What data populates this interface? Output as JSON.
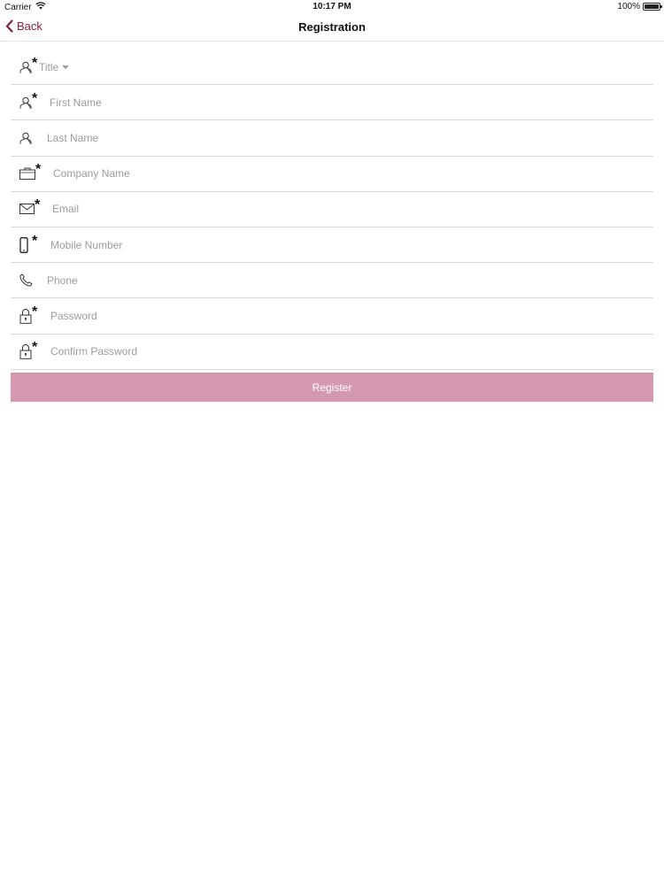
{
  "status_bar": {
    "carrier": "Carrier",
    "time": "10:17 PM",
    "battery": "100%"
  },
  "nav": {
    "back_label": "Back",
    "title": "Registration"
  },
  "form": {
    "title_label": "Title",
    "first_name_placeholder": "First Name",
    "last_name_placeholder": "Last Name",
    "company_placeholder": "Company Name",
    "email_placeholder": "Email",
    "mobile_placeholder": "Mobile Number",
    "phone_placeholder": "Phone",
    "password_placeholder": "Password",
    "confirm_password_placeholder": "Confirm Password",
    "required_marker": "*"
  },
  "register_label": "Register",
  "colors": {
    "accent": "#8a1c47",
    "button": "#d498b1"
  }
}
